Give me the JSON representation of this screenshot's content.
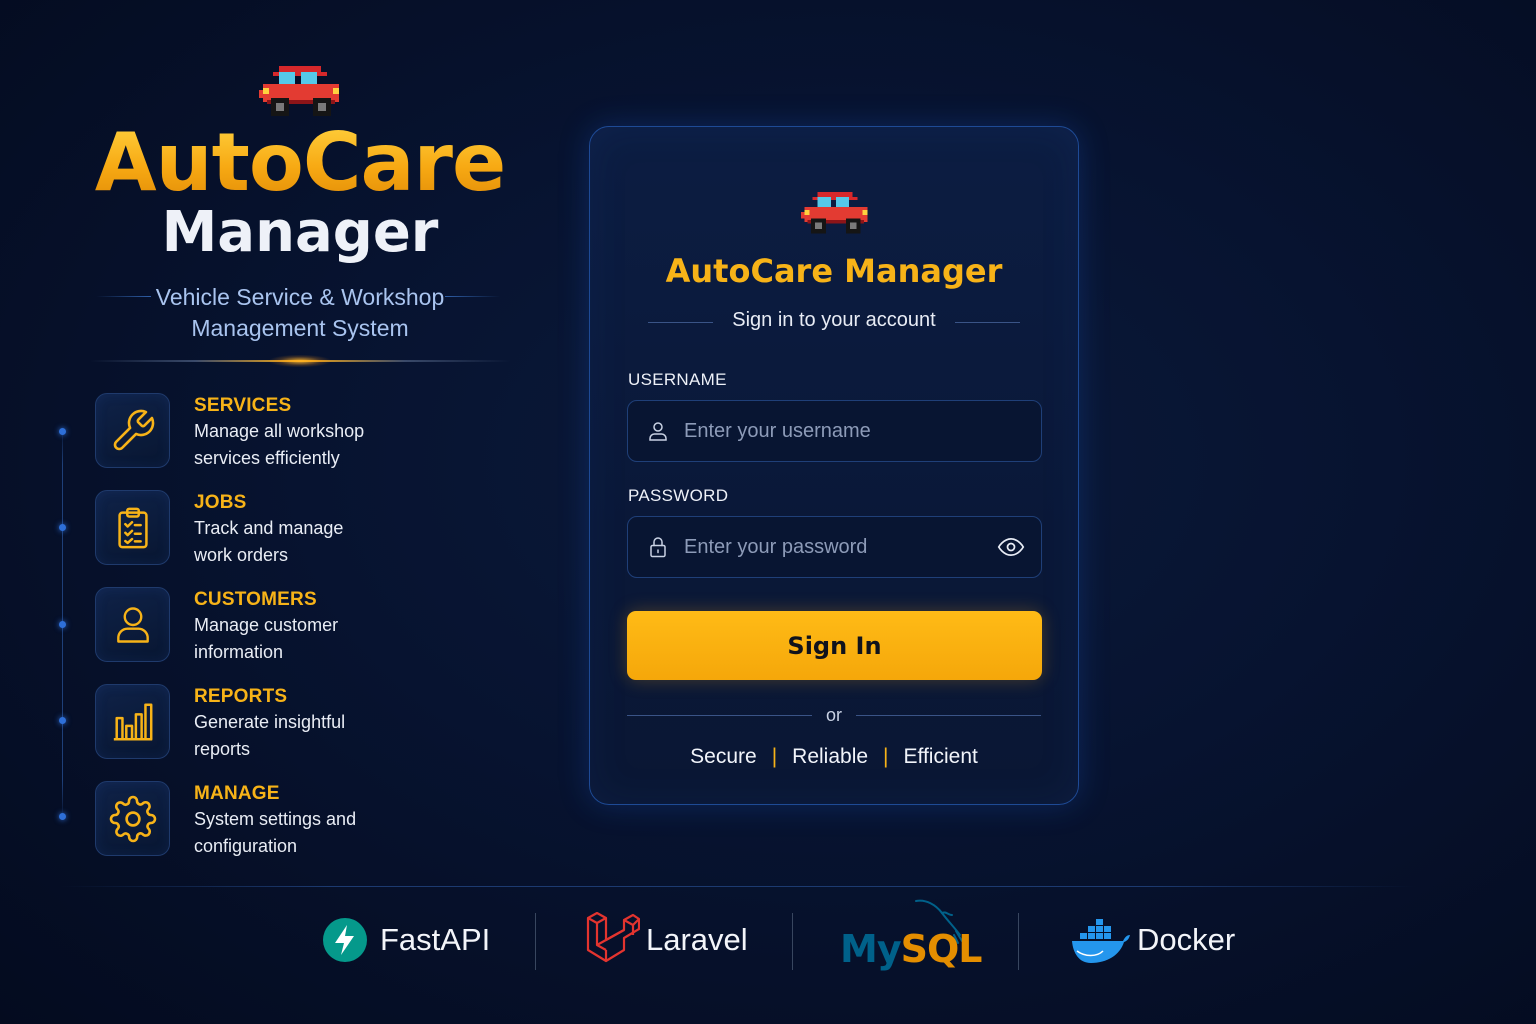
{
  "brand": {
    "title": "AutoCare",
    "subtitle": "Manager",
    "tagline_line1": "Vehicle Service & Workshop",
    "tagline_line2": "Management System",
    "icon": "car-icon"
  },
  "features": [
    {
      "title": "SERVICES",
      "desc": "Manage all workshop services efficiently",
      "icon": "wrench-icon"
    },
    {
      "title": "JOBS",
      "desc": "Track and manage work orders",
      "icon": "clipboard-checklist-icon"
    },
    {
      "title": "CUSTOMERS",
      "desc": "Manage customer information",
      "icon": "user-icon"
    },
    {
      "title": "REPORTS",
      "desc": "Generate insightful reports",
      "icon": "bar-chart-icon"
    },
    {
      "title": "MANAGE",
      "desc": "System settings and configuration",
      "icon": "gear-icon"
    }
  ],
  "login": {
    "title": "AutoCare Manager",
    "subtitle": "Sign in to your account",
    "username_label": "USERNAME",
    "username_placeholder": "Enter your username",
    "username_value": "",
    "password_label": "PASSWORD",
    "password_placeholder": "Enter your password",
    "password_value": "",
    "signin_label": "Sign In",
    "or_label": "or",
    "traits": [
      "Secure",
      "Reliable",
      "Efficient"
    ]
  },
  "tech_stack": [
    {
      "name": "FastAPI",
      "icon": "fastapi-logo-icon"
    },
    {
      "name": "Laravel",
      "icon": "laravel-logo-icon"
    },
    {
      "name": "MySQL",
      "icon": "mysql-dolphin-icon"
    },
    {
      "name": "Docker",
      "icon": "docker-whale-icon"
    }
  ],
  "colors": {
    "accent": "#f7b318",
    "background": "#071330",
    "card_border": "#1e4a95",
    "fastapi": "#05998b",
    "laravel": "#e3342f",
    "mysql_blue": "#00618a",
    "mysql_orange": "#e48e00",
    "docker": "#2496ed"
  }
}
